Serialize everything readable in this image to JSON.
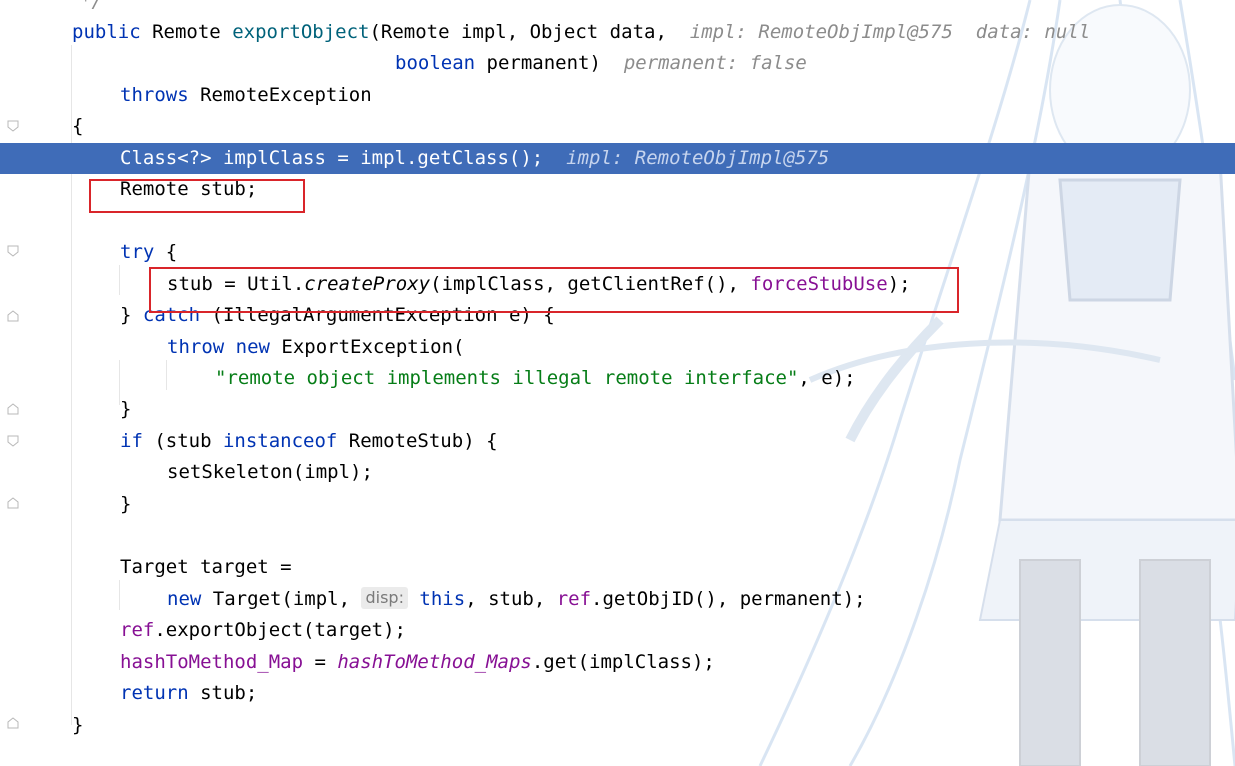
{
  "editor": {
    "lines": {
      "l0": {
        "comment": "*/"
      },
      "l1": {
        "kw_public": "public",
        "type_remote": "Remote",
        "method": "exportObject",
        "params": "(Remote impl, Object data,",
        "hint_impl": "impl: RemoteObjImpl@575",
        "hint_data": "data: null"
      },
      "l2": {
        "kw_boolean": "boolean",
        "rest": " permanent)",
        "hint_permanent": "permanent: false"
      },
      "l3": {
        "kw_throws": "throws",
        "rest": " RemoteException"
      },
      "l4": {
        "brace": "{"
      },
      "l5": {
        "code": "Class<?> implClass = impl.getClass();",
        "hint": "impl: RemoteObjImpl@575"
      },
      "l6": {
        "code": "Remote stub;"
      },
      "l8": {
        "kw_try": "try",
        "rest": " {"
      },
      "l9": {
        "a": "stub = Util.",
        "call": "createProxy",
        "b": "(implClass, getClientRef(), ",
        "field": "forceStubUse",
        "c": ");"
      },
      "l10": {
        "a": "} ",
        "kw_catch": "catch",
        "b": " (IllegalArgumentException e) {"
      },
      "l11": {
        "kw_throw": "throw",
        "kw_new": "new",
        "rest": " ExportException("
      },
      "l12": {
        "string": "\"remote object implements illegal remote interface\"",
        "rest": ", e);"
      },
      "l13": {
        "brace": "}"
      },
      "l14": {
        "kw_if": "if",
        "a": " (stub ",
        "kw_instanceof": "instanceof",
        "b": " RemoteStub) {"
      },
      "l15": {
        "code": "setSkeleton(impl);"
      },
      "l16": {
        "brace": "}"
      },
      "l18": {
        "code": "Target target ="
      },
      "l19": {
        "kw_new": "new",
        "a": " Target(impl, ",
        "param_hint": "disp:",
        "kw_this": "this",
        "b": ", stub, ",
        "field_ref": "ref",
        "c": ".getObjID(), permanent);"
      },
      "l20": {
        "field_ref": "ref",
        "rest": ".exportObject(target);"
      },
      "l21": {
        "field": "hashToMethod_Map",
        "a": " = ",
        "sfield": "hashToMethod_Maps",
        "b": ".get(implClass);"
      },
      "l22": {
        "kw_return": "return",
        "rest": " stub;"
      },
      "l23": {
        "brace": "}"
      }
    }
  },
  "colors": {
    "keyword": "#0033b3",
    "method": "#00627a",
    "string": "#067d17",
    "field": "#871094",
    "hint": "#8c8c8c",
    "execution_line": "#3f6cb8",
    "annotation_box": "#d9252a"
  }
}
